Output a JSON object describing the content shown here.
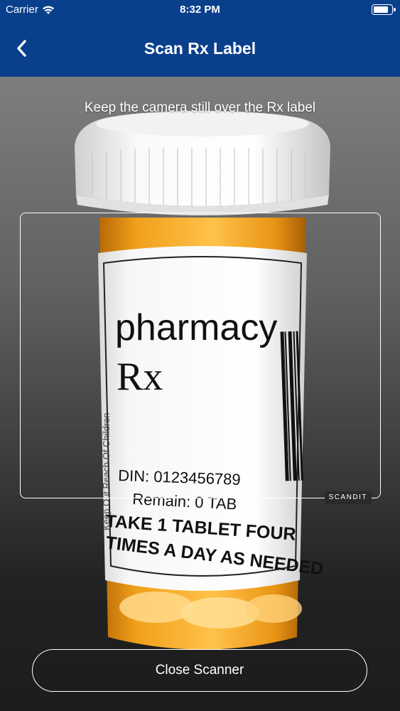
{
  "status": {
    "carrier": "Carrier",
    "time": "8:32 PM",
    "battery_level": 0.85
  },
  "nav": {
    "title": "Scan Rx Label",
    "back_icon": "chevron-left-icon"
  },
  "scanner": {
    "hint": "Keep the camera still over the Rx label",
    "brand": "SCANDIT",
    "close_label": "Close Scanner"
  },
  "label": {
    "pharmacy": "pharmacy",
    "rx": "Rx",
    "side_text": "Keep Out Reach Of Children",
    "din": "DIN: 0123456789",
    "remain": "Remain: 0 TAB",
    "instruction_line1": "TAKE 1 TABLET FOUR",
    "instruction_line2": "TIMES A DAY AS NEEDED"
  },
  "colors": {
    "brand_blue": "#0a3f8c",
    "bottle_orange": "#f5a21b",
    "cap_white": "#f4f4f4"
  }
}
